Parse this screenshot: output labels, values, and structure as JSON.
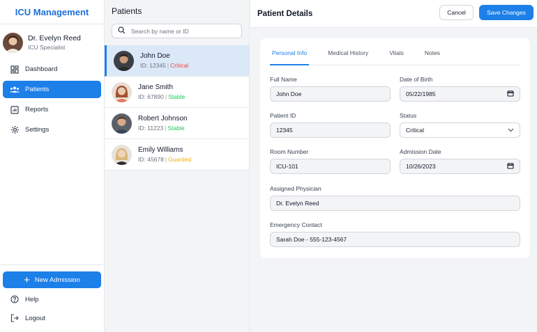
{
  "app": {
    "title": "ICU Management"
  },
  "user": {
    "name": "Dr. Evelyn Reed",
    "role": "ICU Specialist"
  },
  "nav": [
    {
      "label": "Dashboard",
      "icon": "dashboard-icon",
      "active": false
    },
    {
      "label": "Patients",
      "icon": "users-icon",
      "active": true
    },
    {
      "label": "Reports",
      "icon": "chart-icon",
      "active": false
    },
    {
      "label": "Settings",
      "icon": "gear-icon",
      "active": false
    }
  ],
  "sidebar_bottom": {
    "new_admission": "New Admission",
    "help": "Help",
    "logout": "Logout"
  },
  "patients_panel": {
    "title": "Patients",
    "search_placeholder": "Search by name or ID",
    "items": [
      {
        "name": "John Doe",
        "id": "ID: 12345",
        "status": "Critical",
        "status_class": "critical",
        "selected": true
      },
      {
        "name": "Jane Smith",
        "id": "ID: 67890",
        "status": "Stable",
        "status_class": "stable",
        "selected": false
      },
      {
        "name": "Robert Johnson",
        "id": "ID: 11223",
        "status": "Stable",
        "status_class": "stable",
        "selected": false
      },
      {
        "name": "Emily Williams",
        "id": "ID: 45678",
        "status": "Guarded",
        "status_class": "guarded",
        "selected": false
      }
    ]
  },
  "details": {
    "title": "Patient Details",
    "cancel": "Cancel",
    "save": "Save Changes",
    "tabs": [
      "Personal Info",
      "Medical History",
      "Vitals",
      "Notes"
    ],
    "fields": {
      "full_name": {
        "label": "Full Name",
        "value": "John Doe"
      },
      "dob": {
        "label": "Date of Birth",
        "value": "05/22/1985"
      },
      "patient_id": {
        "label": "Patient ID",
        "value": "12345"
      },
      "status": {
        "label": "Status",
        "value": "Critical"
      },
      "room": {
        "label": "Room Number",
        "value": "ICU-101"
      },
      "admission_date": {
        "label": "Admission Date",
        "value": "10/26/2023"
      },
      "physician": {
        "label": "Assigned Physician",
        "value": "Dr. Evelyn Reed"
      },
      "emergency": {
        "label": "Emergency Contact",
        "value": "Sarah Doe - 555-123-4567"
      }
    }
  },
  "colors": {
    "accent": "#1d7fe8",
    "critical": "#ef4444",
    "stable": "#22c55e",
    "guarded": "#eab308"
  }
}
